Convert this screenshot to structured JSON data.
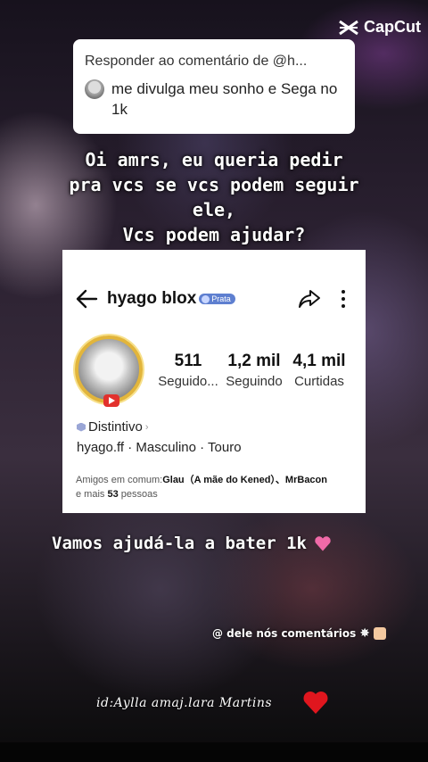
{
  "watermark": {
    "brand": "CapCut"
  },
  "reply": {
    "title": "Responder ao comentário de @h...",
    "comment": "me divulga meu sonho e Sega no 1k"
  },
  "overlay": {
    "text": "Oi amrs, eu queria pedir\npra vcs se vcs podem seguir\nele,\nVcs podem ajudar?"
  },
  "profile": {
    "name": "hyago blox",
    "badge": "Prata",
    "stats": [
      {
        "value": "511",
        "label": "Seguido..."
      },
      {
        "value": "1,2 mil",
        "label": "Seguindo"
      },
      {
        "value": "4,1 mil",
        "label": "Curtidas"
      }
    ],
    "distintivo": "Distintivo",
    "info": "hyago.ff · Masculino · Touro",
    "friends_prefix": "Amigos em comum:",
    "friends_names": "Glau（A mãe do Kened）、MrBacon",
    "friends_more_prefix": "e mais ",
    "friends_count": "53",
    "friends_more_suffix": " pessoas"
  },
  "help_text": "Vamos ajudá-la a bater 1k",
  "comments_text": "@ dele nós comentários",
  "signature": "id:Aylla amaj.lara Martins",
  "colors": {
    "heart_pink": "#f06aa8",
    "heart_red": "#e0161e",
    "badge": "#5e7fd0",
    "avatar_ring": "#e2b53b"
  },
  "icons": [
    "capcut-logo-icon",
    "back-arrow-icon",
    "share-icon",
    "more-vertical-icon",
    "badge-icon",
    "live-icon",
    "hexagon-icon",
    "chevron-right-icon",
    "pink-heart-icon",
    "burst-icon",
    "thumbs-up-icon",
    "red-heart-icon"
  ]
}
